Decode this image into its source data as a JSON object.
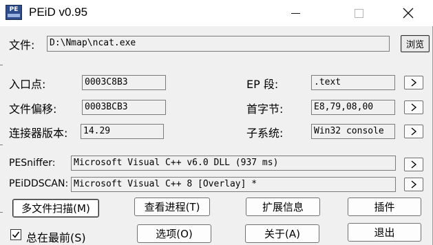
{
  "window": {
    "title": "PEiD v0.95",
    "icon_text": "PE"
  },
  "file": {
    "label": "文件:",
    "value": "D:\\Nmap\\ncat.exe",
    "browse_label": "浏览"
  },
  "info": {
    "entry_point_label": "入口点:",
    "entry_point_value": "0003C8B3",
    "file_offset_label": "文件偏移:",
    "file_offset_value": "0003BCB3",
    "linker_version_label": "连接器版本:",
    "linker_version_value": "14.29",
    "ep_section_label": "EP 段:",
    "ep_section_value": ".text",
    "first_bytes_label": "首字节:",
    "first_bytes_value": "E8,79,08,00",
    "subsystem_label": "子系统:",
    "subsystem_value": "Win32 console"
  },
  "scan": {
    "pesniffer_label": "PESniffer:",
    "pesniffer_value": "Microsoft Visual C++ v6.0 DLL (937 ms)",
    "peiddscan_label": "PEiDDSCAN:",
    "peiddscan_value": "Microsoft Visual C++ 8 [Overlay] *",
    "arrow_glyph": ">"
  },
  "buttons": {
    "multi_scan": "多文件扫描(M)",
    "view_process": "查看进程(T)",
    "extensions": "扩展信息",
    "plugins": "插件",
    "options": "选项(O)",
    "about": "关于(A)",
    "exit": "退出"
  },
  "always_on_top": {
    "label": "总在最前(S)",
    "checked": true
  },
  "icons": {
    "minimize": "minimize-icon",
    "maximize": "maximize-icon",
    "close": "close-icon",
    "check": "check-icon"
  }
}
